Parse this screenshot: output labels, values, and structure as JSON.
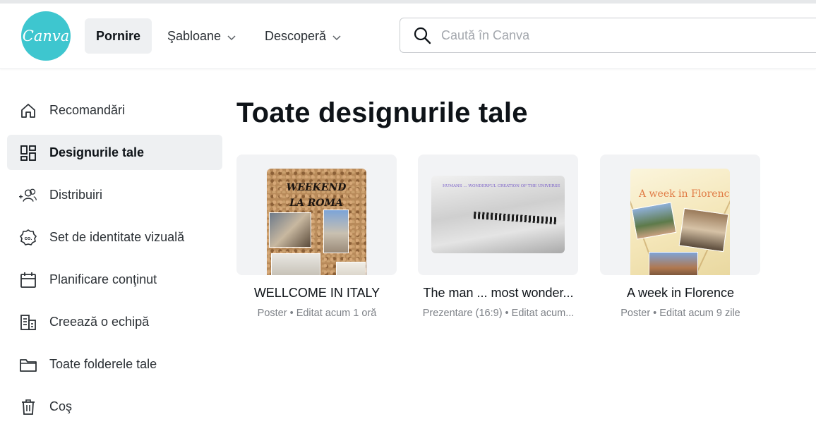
{
  "header": {
    "logo_text": "Canva",
    "nav": {
      "home": "Pornire",
      "templates": "Şabloane",
      "discover": "Descoperă"
    },
    "search": {
      "placeholder": "Caută în Canva",
      "value": ""
    }
  },
  "sidebar": {
    "items": [
      {
        "label": "Recomandări",
        "icon": "home-icon",
        "active": false
      },
      {
        "label": "Designurile tale",
        "icon": "grid-icon",
        "active": true
      },
      {
        "label": "Distribuiri",
        "icon": "add-people-icon",
        "active": false
      },
      {
        "label": "Set de identitate vizuală",
        "icon": "brand-kit-icon",
        "active": false
      },
      {
        "label": "Planificare conţinut",
        "icon": "calendar-icon",
        "active": false
      },
      {
        "label": "Creează o echipă",
        "icon": "building-icon",
        "active": false
      },
      {
        "label": "Toate folderele tale",
        "icon": "folder-icon",
        "active": false
      },
      {
        "label": "Coş",
        "icon": "trash-icon",
        "active": false
      }
    ]
  },
  "main": {
    "title": "Toate designurile tale",
    "designs": [
      {
        "title": "WELLCOME IN ITALY",
        "meta": "Poster • Editat acum 1 oră",
        "thumb_text": "WEEKEND LA ROMA"
      },
      {
        "title": "The man ... most wonder...",
        "meta": "Prezentare (16:9) • Editat acum...",
        "thumb_text": "HUMANS ... WONDERFUL CREATION OF THE UNIVERSE"
      },
      {
        "title": "A week in Florence",
        "meta": "Poster • Editat acum 9 zile",
        "thumb_text": "A week in Florence"
      }
    ]
  },
  "colors": {
    "brand": "#3ec6cf",
    "active_bg": "#eef0f2",
    "thumb_bg": "#f2f3f5",
    "muted_text": "#7d8187"
  }
}
